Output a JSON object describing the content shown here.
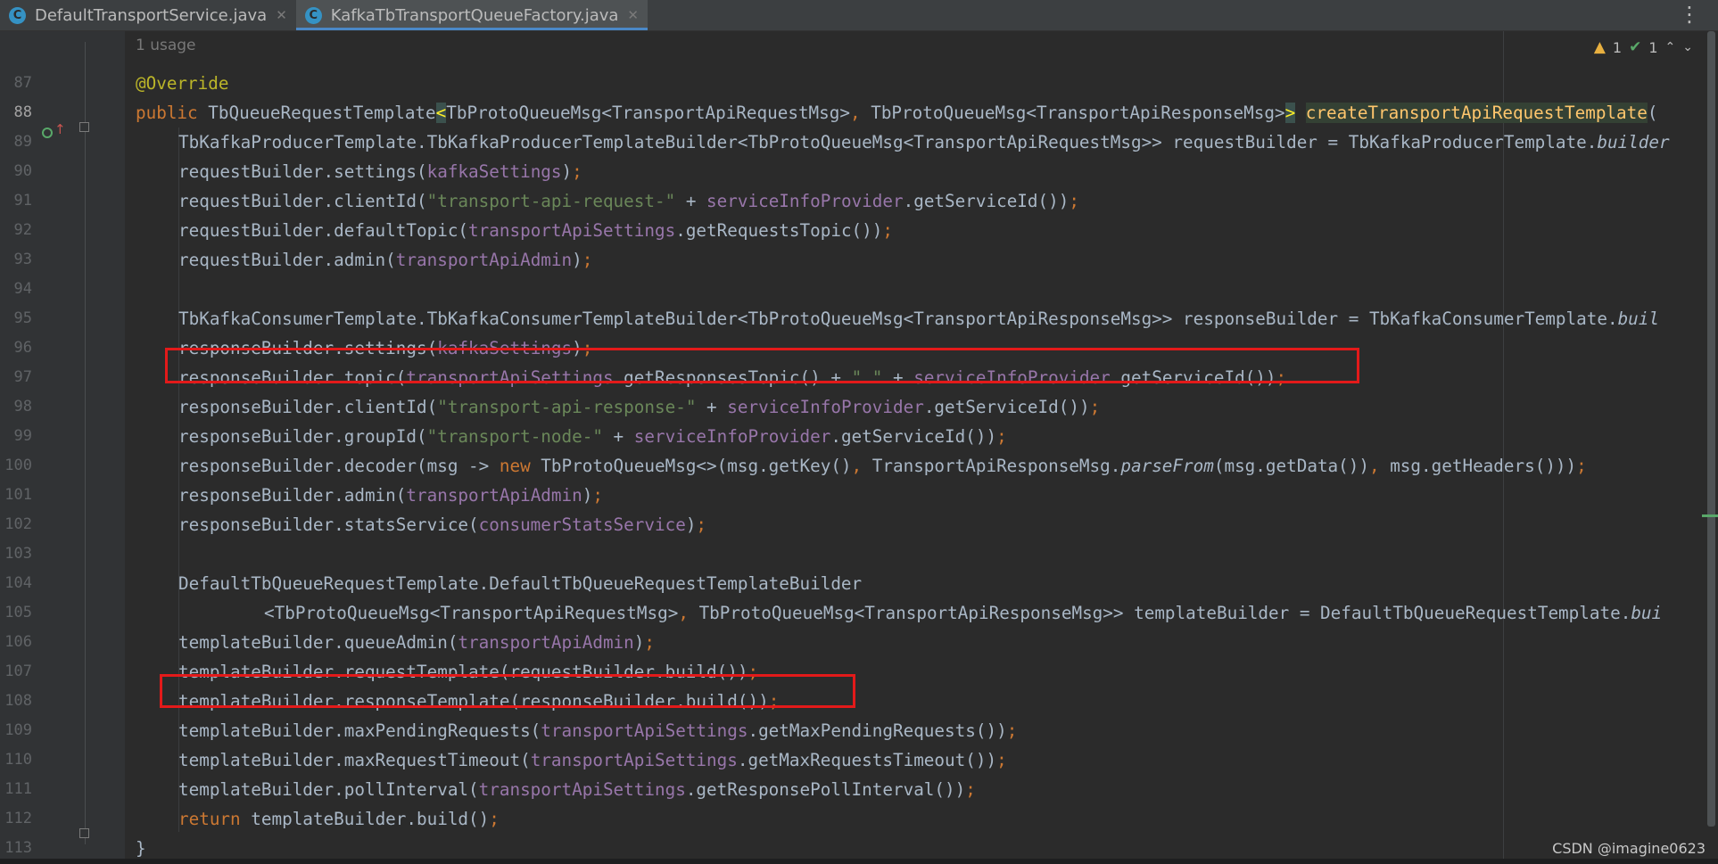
{
  "tabs": [
    {
      "icon_letter": "C",
      "label": "DefaultTransportService.java",
      "active": false
    },
    {
      "icon_letter": "C",
      "label": "KafkaTbTransportQueueFactory.java",
      "active": true
    }
  ],
  "menu_icon": "more-vertical-icon",
  "inspection": {
    "warnings": "1",
    "weak_warnings": "1",
    "warning_icon": "warning-triangle-icon",
    "ok_icon": "checkmark-icon"
  },
  "usage_hint": "1 usage",
  "line_numbers": [
    "87",
    "88",
    "89",
    "90",
    "91",
    "92",
    "93",
    "94",
    "95",
    "96",
    "97",
    "98",
    "99",
    "100",
    "101",
    "102",
    "103",
    "104",
    "105",
    "106",
    "107",
    "108",
    "109",
    "110",
    "111",
    "112",
    "113"
  ],
  "watermark": "CSDN @imagine0623",
  "highlight_color": "#e31a1a"
}
